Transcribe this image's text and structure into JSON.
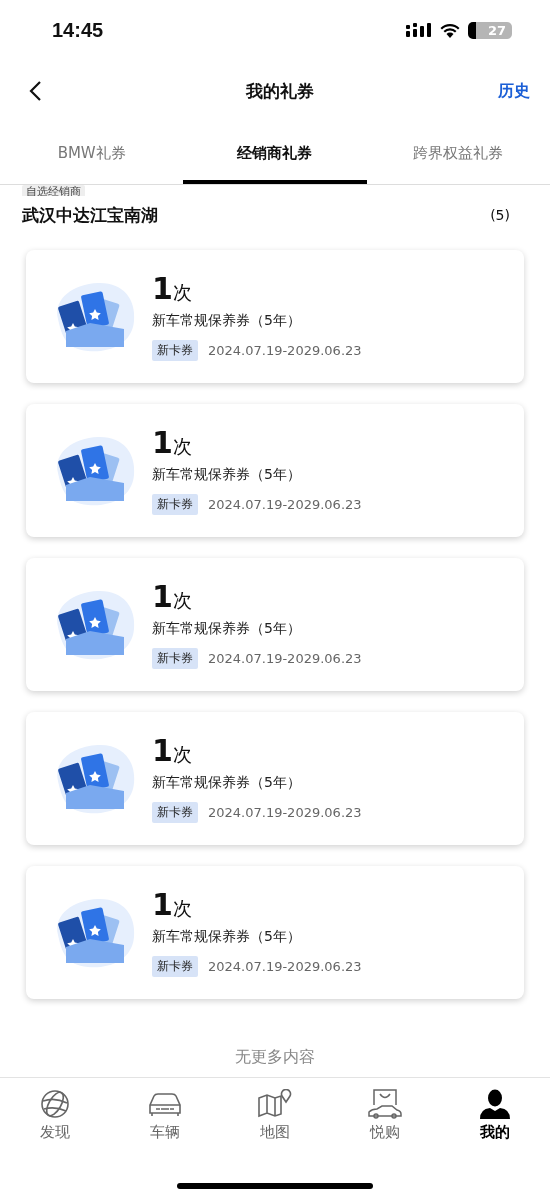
{
  "status_bar": {
    "time": "14:45",
    "battery": "27"
  },
  "header": {
    "title": "我的礼券",
    "action": "历史"
  },
  "tabs": [
    {
      "label": "BMW礼券",
      "selected": false
    },
    {
      "label": "经销商礼券",
      "selected": true
    },
    {
      "label": "跨界权益礼券",
      "selected": false
    }
  ],
  "dealer": {
    "tag": "自选经销商",
    "name": "武汉中达江宝南湖",
    "count": "(5)"
  },
  "coupons": [
    {
      "number": "1",
      "unit": "次",
      "title": "新车常规保养券（5年）",
      "tag": "新卡券",
      "validity": "2024.07.19-2029.06.23"
    },
    {
      "number": "1",
      "unit": "次",
      "title": "新车常规保养券（5年）",
      "tag": "新卡券",
      "validity": "2024.07.19-2029.06.23"
    },
    {
      "number": "1",
      "unit": "次",
      "title": "新车常规保养券（5年）",
      "tag": "新卡券",
      "validity": "2024.07.19-2029.06.23"
    },
    {
      "number": "1",
      "unit": "次",
      "title": "新车常规保养券（5年）",
      "tag": "新卡券",
      "validity": "2024.07.19-2029.06.23"
    },
    {
      "number": "1",
      "unit": "次",
      "title": "新车常规保养券（5年）",
      "tag": "新卡券",
      "validity": "2024.07.19-2029.06.23"
    }
  ],
  "end_note": "无更多内容",
  "bottom_nav": [
    {
      "kind": "globe",
      "label": "发现",
      "selected": false
    },
    {
      "kind": "car",
      "label": "车辆",
      "selected": false
    },
    {
      "kind": "map",
      "label": "地图",
      "selected": false
    },
    {
      "kind": "shop",
      "label": "悦购",
      "selected": false
    },
    {
      "kind": "person",
      "label": "我的",
      "selected": true
    }
  ]
}
